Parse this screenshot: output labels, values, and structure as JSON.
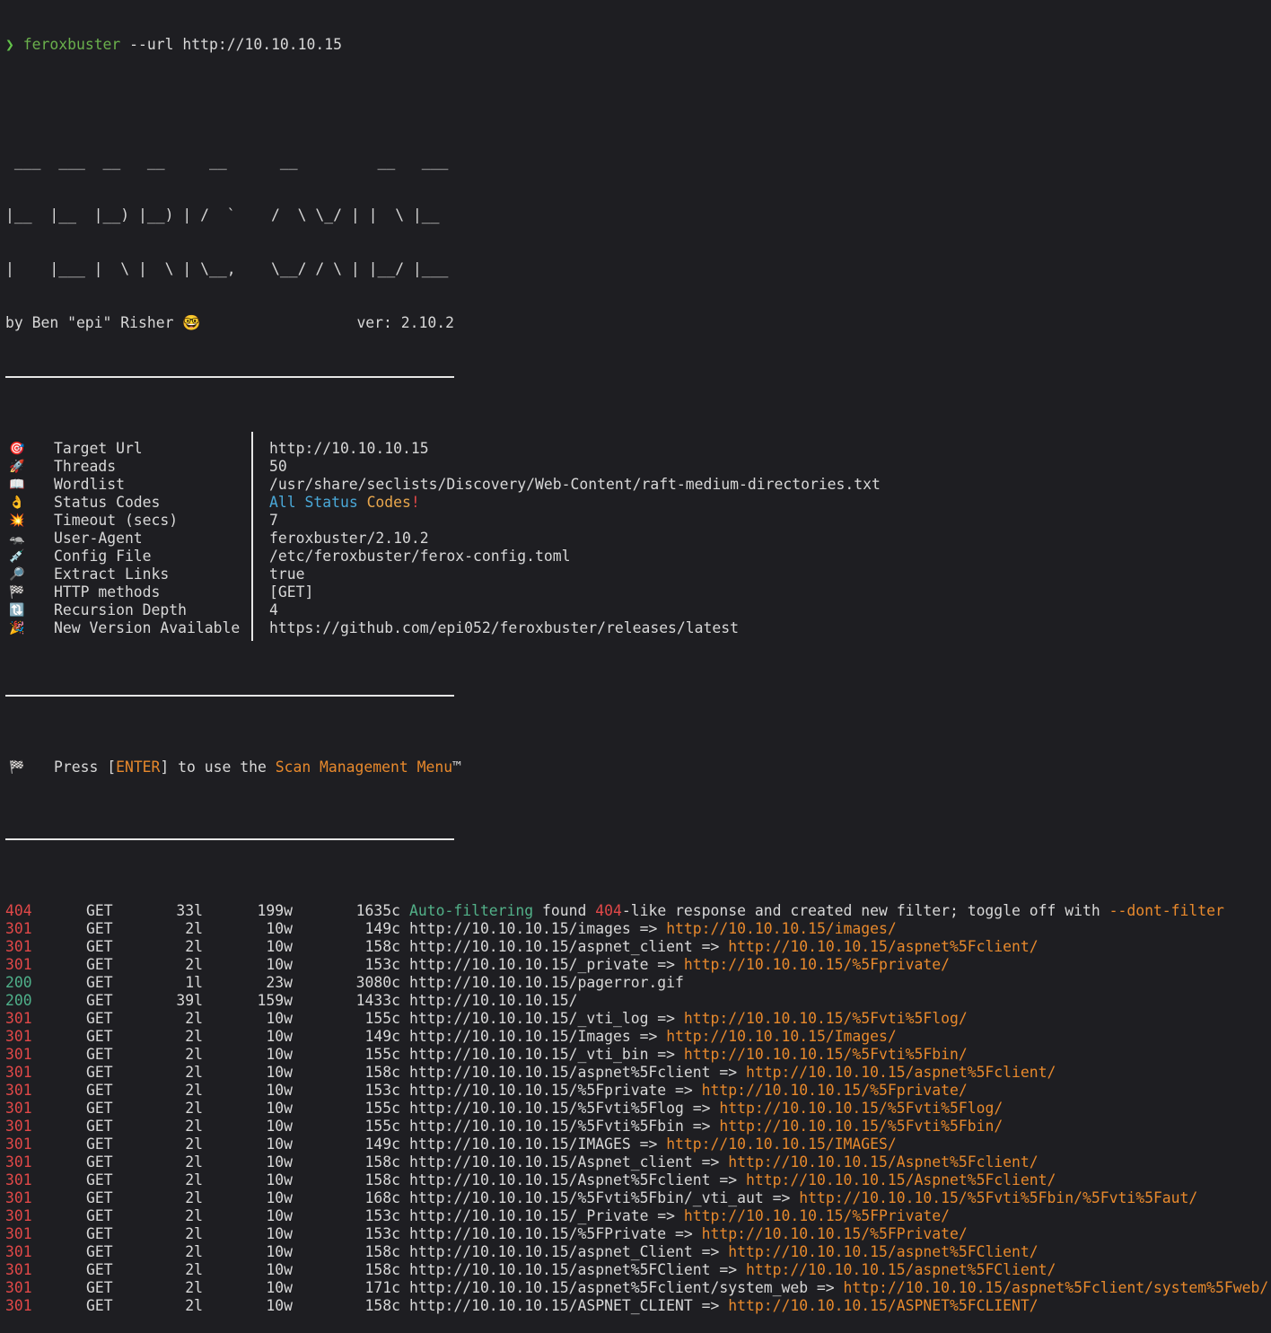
{
  "prompt": {
    "arrow": "❯",
    "command": "feroxbuster",
    "args": " --url http://10.10.10.15"
  },
  "banner": {
    "art": [
      " ___  ___  __   __     __      __         __   ___",
      "|__  |__  |__) |__) | /  `    /  \\ \\_/ | |  \\ |__",
      "|    |___ |  \\ |  \\ | \\__,    \\__/ / \\ | |__/ |___"
    ],
    "byline": "by Ben \"epi\" Risher 🤓",
    "version": "ver: 2.10.2"
  },
  "config": [
    {
      "icon": "🎯",
      "key": "Target Url",
      "value": "http://10.10.10.15"
    },
    {
      "icon": "🚀",
      "key": "Threads",
      "value": "50"
    },
    {
      "icon": "📖",
      "key": "Wordlist",
      "value": "/usr/share/seclists/Discovery/Web-Content/raft-medium-directories.txt"
    },
    {
      "icon": "👌",
      "key": "Status Codes",
      "value_parts": [
        {
          "text": "All ",
          "color": "blue"
        },
        {
          "text": "Status ",
          "color": "blue"
        },
        {
          "text": "Codes",
          "color": "yellow"
        },
        {
          "text": "!",
          "color": "red"
        }
      ]
    },
    {
      "icon": "💥",
      "key": "Timeout (secs)",
      "value": "7"
    },
    {
      "icon": "🦡",
      "key": "User-Agent",
      "value": "feroxbuster/2.10.2"
    },
    {
      "icon": "💉",
      "key": "Config File",
      "value": "/etc/feroxbuster/ferox-config.toml"
    },
    {
      "icon": "🔎",
      "key": "Extract Links",
      "value": "true"
    },
    {
      "icon": "🏁",
      "key": "HTTP methods",
      "value": "[GET]"
    },
    {
      "icon": "🔃",
      "key": "Recursion Depth",
      "value": "4"
    },
    {
      "icon": "🎉",
      "key": "New Version Available",
      "value": "https://github.com/epi052/feroxbuster/releases/latest"
    }
  ],
  "press": {
    "icon": "🏁",
    "before": "Press [",
    "key": "ENTER",
    "middle": "] to use the ",
    "menu": "Scan Management Menu",
    "tm": "™"
  },
  "results": [
    {
      "status": "404",
      "method": "GET",
      "lines": "33l",
      "words": "199w",
      "chars": "1635c",
      "filter": true,
      "msg_parts": [
        {
          "text": "Auto-filtering",
          "color": "green"
        },
        {
          "text": " found ",
          "color": ""
        },
        {
          "text": "404",
          "color": "red"
        },
        {
          "text": "-like response and created new filter; toggle off with ",
          "color": ""
        },
        {
          "text": "--dont-filter",
          "color": "orange"
        }
      ]
    },
    {
      "status": "301",
      "method": "GET",
      "lines": "2l",
      "words": "10w",
      "chars": "149c",
      "url": "http://10.10.10.15/images",
      "redirect": "http://10.10.10.15/images/"
    },
    {
      "status": "301",
      "method": "GET",
      "lines": "2l",
      "words": "10w",
      "chars": "158c",
      "url": "http://10.10.10.15/aspnet_client",
      "redirect": "http://10.10.10.15/aspnet%5Fclient/"
    },
    {
      "status": "301",
      "method": "GET",
      "lines": "2l",
      "words": "10w",
      "chars": "153c",
      "url": "http://10.10.10.15/_private",
      "redirect": "http://10.10.10.15/%5Fprivate/"
    },
    {
      "status": "200",
      "method": "GET",
      "lines": "1l",
      "words": "23w",
      "chars": "3080c",
      "url": "http://10.10.10.15/pagerror.gif",
      "redirect": ""
    },
    {
      "status": "200",
      "method": "GET",
      "lines": "39l",
      "words": "159w",
      "chars": "1433c",
      "url": "http://10.10.10.15/",
      "redirect": ""
    },
    {
      "status": "301",
      "method": "GET",
      "lines": "2l",
      "words": "10w",
      "chars": "155c",
      "url": "http://10.10.10.15/_vti_log",
      "redirect": "http://10.10.10.15/%5Fvti%5Flog/"
    },
    {
      "status": "301",
      "method": "GET",
      "lines": "2l",
      "words": "10w",
      "chars": "149c",
      "url": "http://10.10.10.15/Images",
      "redirect": "http://10.10.10.15/Images/"
    },
    {
      "status": "301",
      "method": "GET",
      "lines": "2l",
      "words": "10w",
      "chars": "155c",
      "url": "http://10.10.10.15/_vti_bin",
      "redirect": "http://10.10.10.15/%5Fvti%5Fbin/"
    },
    {
      "status": "301",
      "method": "GET",
      "lines": "2l",
      "words": "10w",
      "chars": "158c",
      "url": "http://10.10.10.15/aspnet%5Fclient",
      "redirect": "http://10.10.10.15/aspnet%5Fclient/"
    },
    {
      "status": "301",
      "method": "GET",
      "lines": "2l",
      "words": "10w",
      "chars": "153c",
      "url": "http://10.10.10.15/%5Fprivate",
      "redirect": "http://10.10.10.15/%5Fprivate/"
    },
    {
      "status": "301",
      "method": "GET",
      "lines": "2l",
      "words": "10w",
      "chars": "155c",
      "url": "http://10.10.10.15/%5Fvti%5Flog",
      "redirect": "http://10.10.10.15/%5Fvti%5Flog/"
    },
    {
      "status": "301",
      "method": "GET",
      "lines": "2l",
      "words": "10w",
      "chars": "155c",
      "url": "http://10.10.10.15/%5Fvti%5Fbin",
      "redirect": "http://10.10.10.15/%5Fvti%5Fbin/"
    },
    {
      "status": "301",
      "method": "GET",
      "lines": "2l",
      "words": "10w",
      "chars": "149c",
      "url": "http://10.10.10.15/IMAGES",
      "redirect": "http://10.10.10.15/IMAGES/"
    },
    {
      "status": "301",
      "method": "GET",
      "lines": "2l",
      "words": "10w",
      "chars": "158c",
      "url": "http://10.10.10.15/Aspnet_client",
      "redirect": "http://10.10.10.15/Aspnet%5Fclient/"
    },
    {
      "status": "301",
      "method": "GET",
      "lines": "2l",
      "words": "10w",
      "chars": "158c",
      "url": "http://10.10.10.15/Aspnet%5Fclient",
      "redirect": "http://10.10.10.15/Aspnet%5Fclient/"
    },
    {
      "status": "301",
      "method": "GET",
      "lines": "2l",
      "words": "10w",
      "chars": "168c",
      "url": "http://10.10.10.15/%5Fvti%5Fbin/_vti_aut",
      "redirect": "http://10.10.10.15/%5Fvti%5Fbin/%5Fvti%5Faut/"
    },
    {
      "status": "301",
      "method": "GET",
      "lines": "2l",
      "words": "10w",
      "chars": "153c",
      "url": "http://10.10.10.15/_Private",
      "redirect": "http://10.10.10.15/%5FPrivate/"
    },
    {
      "status": "301",
      "method": "GET",
      "lines": "2l",
      "words": "10w",
      "chars": "153c",
      "url": "http://10.10.10.15/%5FPrivate",
      "redirect": "http://10.10.10.15/%5FPrivate/"
    },
    {
      "status": "301",
      "method": "GET",
      "lines": "2l",
      "words": "10w",
      "chars": "158c",
      "url": "http://10.10.10.15/aspnet_Client",
      "redirect": "http://10.10.10.15/aspnet%5FClient/"
    },
    {
      "status": "301",
      "method": "GET",
      "lines": "2l",
      "words": "10w",
      "chars": "158c",
      "url": "http://10.10.10.15/aspnet%5FClient",
      "redirect": "http://10.10.10.15/aspnet%5FClient/"
    },
    {
      "status": "301",
      "method": "GET",
      "lines": "2l",
      "words": "10w",
      "chars": "171c",
      "url": "http://10.10.10.15/aspnet%5Fclient/system_web",
      "redirect": "http://10.10.10.15/aspnet%5Fclient/system%5Fweb/"
    },
    {
      "status": "301",
      "method": "GET",
      "lines": "2l",
      "words": "10w",
      "chars": "158c",
      "url": "http://10.10.10.15/ASPNET_CLIENT",
      "redirect": "http://10.10.10.15/ASPNET%5FCLIENT/"
    }
  ],
  "colors": {
    "background": "#1e1e22",
    "foreground": "#d8d8d8",
    "green": "#6ab04c",
    "red": "#e04848",
    "orange": "#e8892c",
    "blue": "#4aa8d8",
    "teal": "#4fb08a"
  }
}
